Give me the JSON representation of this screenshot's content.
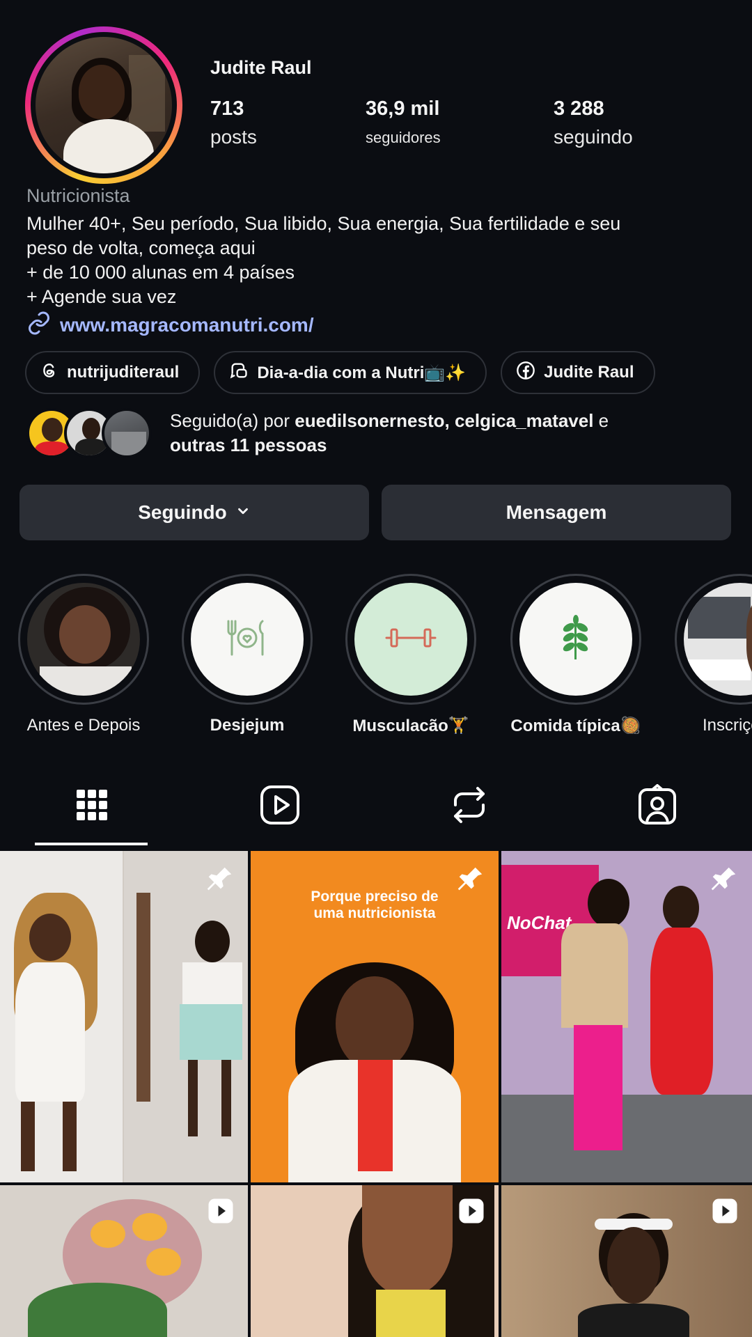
{
  "profile": {
    "name": "Judite Raul",
    "stats": [
      {
        "value": "713",
        "label": "posts"
      },
      {
        "value": "36,9 mil",
        "label": "seguidores"
      },
      {
        "value": "3 288",
        "label": "seguindo"
      }
    ],
    "category": "Nutricionista",
    "bio": "Mulher 40+, Seu período, Sua libido, Sua energia, Sua fertilidade  e seu\npeso de volta, começa aqui\n + de 10 000 alunas em 4 países\n + Agende sua vez",
    "link": "www.magracomanutri.com/"
  },
  "chips": [
    {
      "label": "nutrijuditeraul",
      "icon": "threads-icon"
    },
    {
      "label": "Dia-a-dia com a Nutri📺✨",
      "icon": "channel-icon"
    },
    {
      "label": "Judite Raul",
      "icon": "facebook-icon"
    }
  ],
  "followed_by": {
    "prefix": "Seguido(a) por ",
    "names": "euedilsonernesto, celgica_matavel",
    "conj": " e",
    "others": "outras 11 pessoas"
  },
  "actions": {
    "following_label": "Seguindo",
    "message_label": "Mensagem"
  },
  "highlights": [
    {
      "label": "Antes e Depois"
    },
    {
      "label": "Desjejum"
    },
    {
      "label": "Musculacão🏋️"
    },
    {
      "label": "Comida típica🥘"
    },
    {
      "label": "Inscrições"
    }
  ],
  "posts": {
    "post2_title_line1": "Porque preciso de",
    "post2_title_line2": "uma nutricionista",
    "post3_brand": "NoChat"
  },
  "colors": {
    "background": "#0b0d12",
    "link": "#a5b8ff",
    "button": "#2b2e35",
    "orange_post": "#f28a1f",
    "pink_post": "#d21e6b"
  }
}
